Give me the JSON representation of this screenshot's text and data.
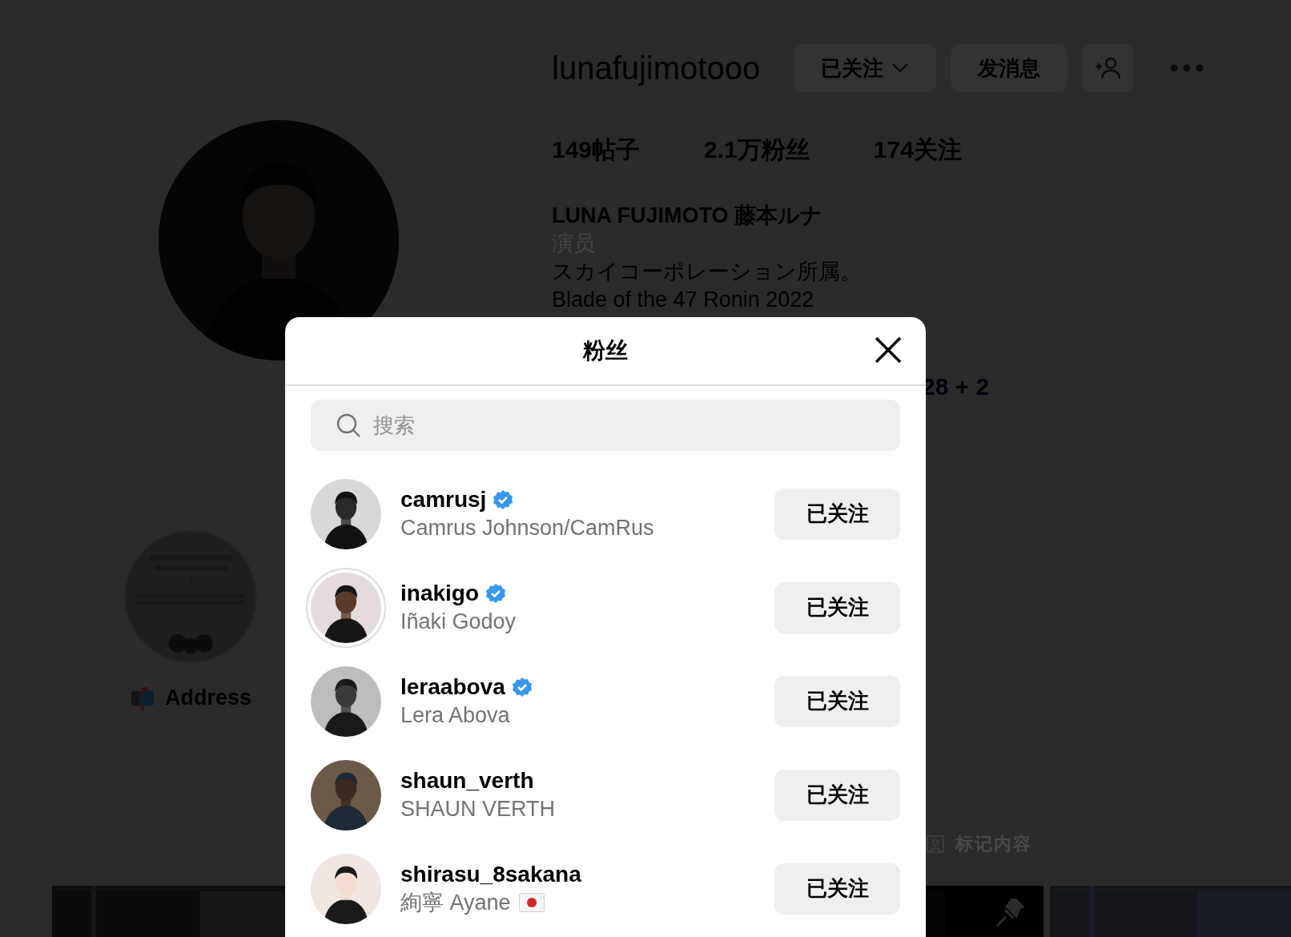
{
  "profile": {
    "username": "lunafujimotooo",
    "buttons": [
      {
        "kind": "dropdown",
        "label": "已关注"
      },
      {
        "kind": "text",
        "label": "发消息"
      },
      {
        "kind": "add-person"
      },
      {
        "kind": "more"
      }
    ],
    "stats": [
      {
        "number": "149",
        "label": "帖子"
      },
      {
        "number": "2.1万",
        "label": "粉丝"
      },
      {
        "number": "174",
        "label": "关注"
      }
    ],
    "bio": {
      "name": "LUNA FUJIMOTO 藤本ルナ",
      "category": "演员",
      "lines": [
        "スカイコーポレーション所属。",
        "Blade of the 47 Ronin 2022"
      ],
      "link": "28 + 2"
    }
  },
  "highlights": [
    {
      "label": "Address"
    }
  ],
  "tabs": [
    {
      "label": "标记内容"
    }
  ],
  "posts": [
    {
      "kind": "picture"
    },
    {
      "kind": "picture",
      "pinned": true
    },
    {
      "kind": "picture"
    }
  ],
  "followers_dialog": {
    "title": "粉丝",
    "search": {
      "placeholder": "搜索"
    },
    "followers": [
      {
        "username": "camrusj",
        "name": "Camrus Johnson/CamRus",
        "verified": true,
        "ring": false,
        "flag": false,
        "button": "已关注"
      },
      {
        "username": "inakigo",
        "name": "Iñaki Godoy",
        "verified": true,
        "ring": true,
        "flag": false,
        "button": "已关注"
      },
      {
        "username": "leraabova",
        "name": "Lera Abova",
        "verified": true,
        "ring": false,
        "flag": false,
        "button": "已关注"
      },
      {
        "username": "shaun_verth",
        "name": "SHAUN VERTH",
        "verified": false,
        "ring": false,
        "flag": false,
        "button": "已关注"
      },
      {
        "username": "shirasu_8sakana",
        "name": "絢寧 Ayane",
        "verified": false,
        "ring": false,
        "flag": true,
        "button": "已关注"
      }
    ]
  }
}
